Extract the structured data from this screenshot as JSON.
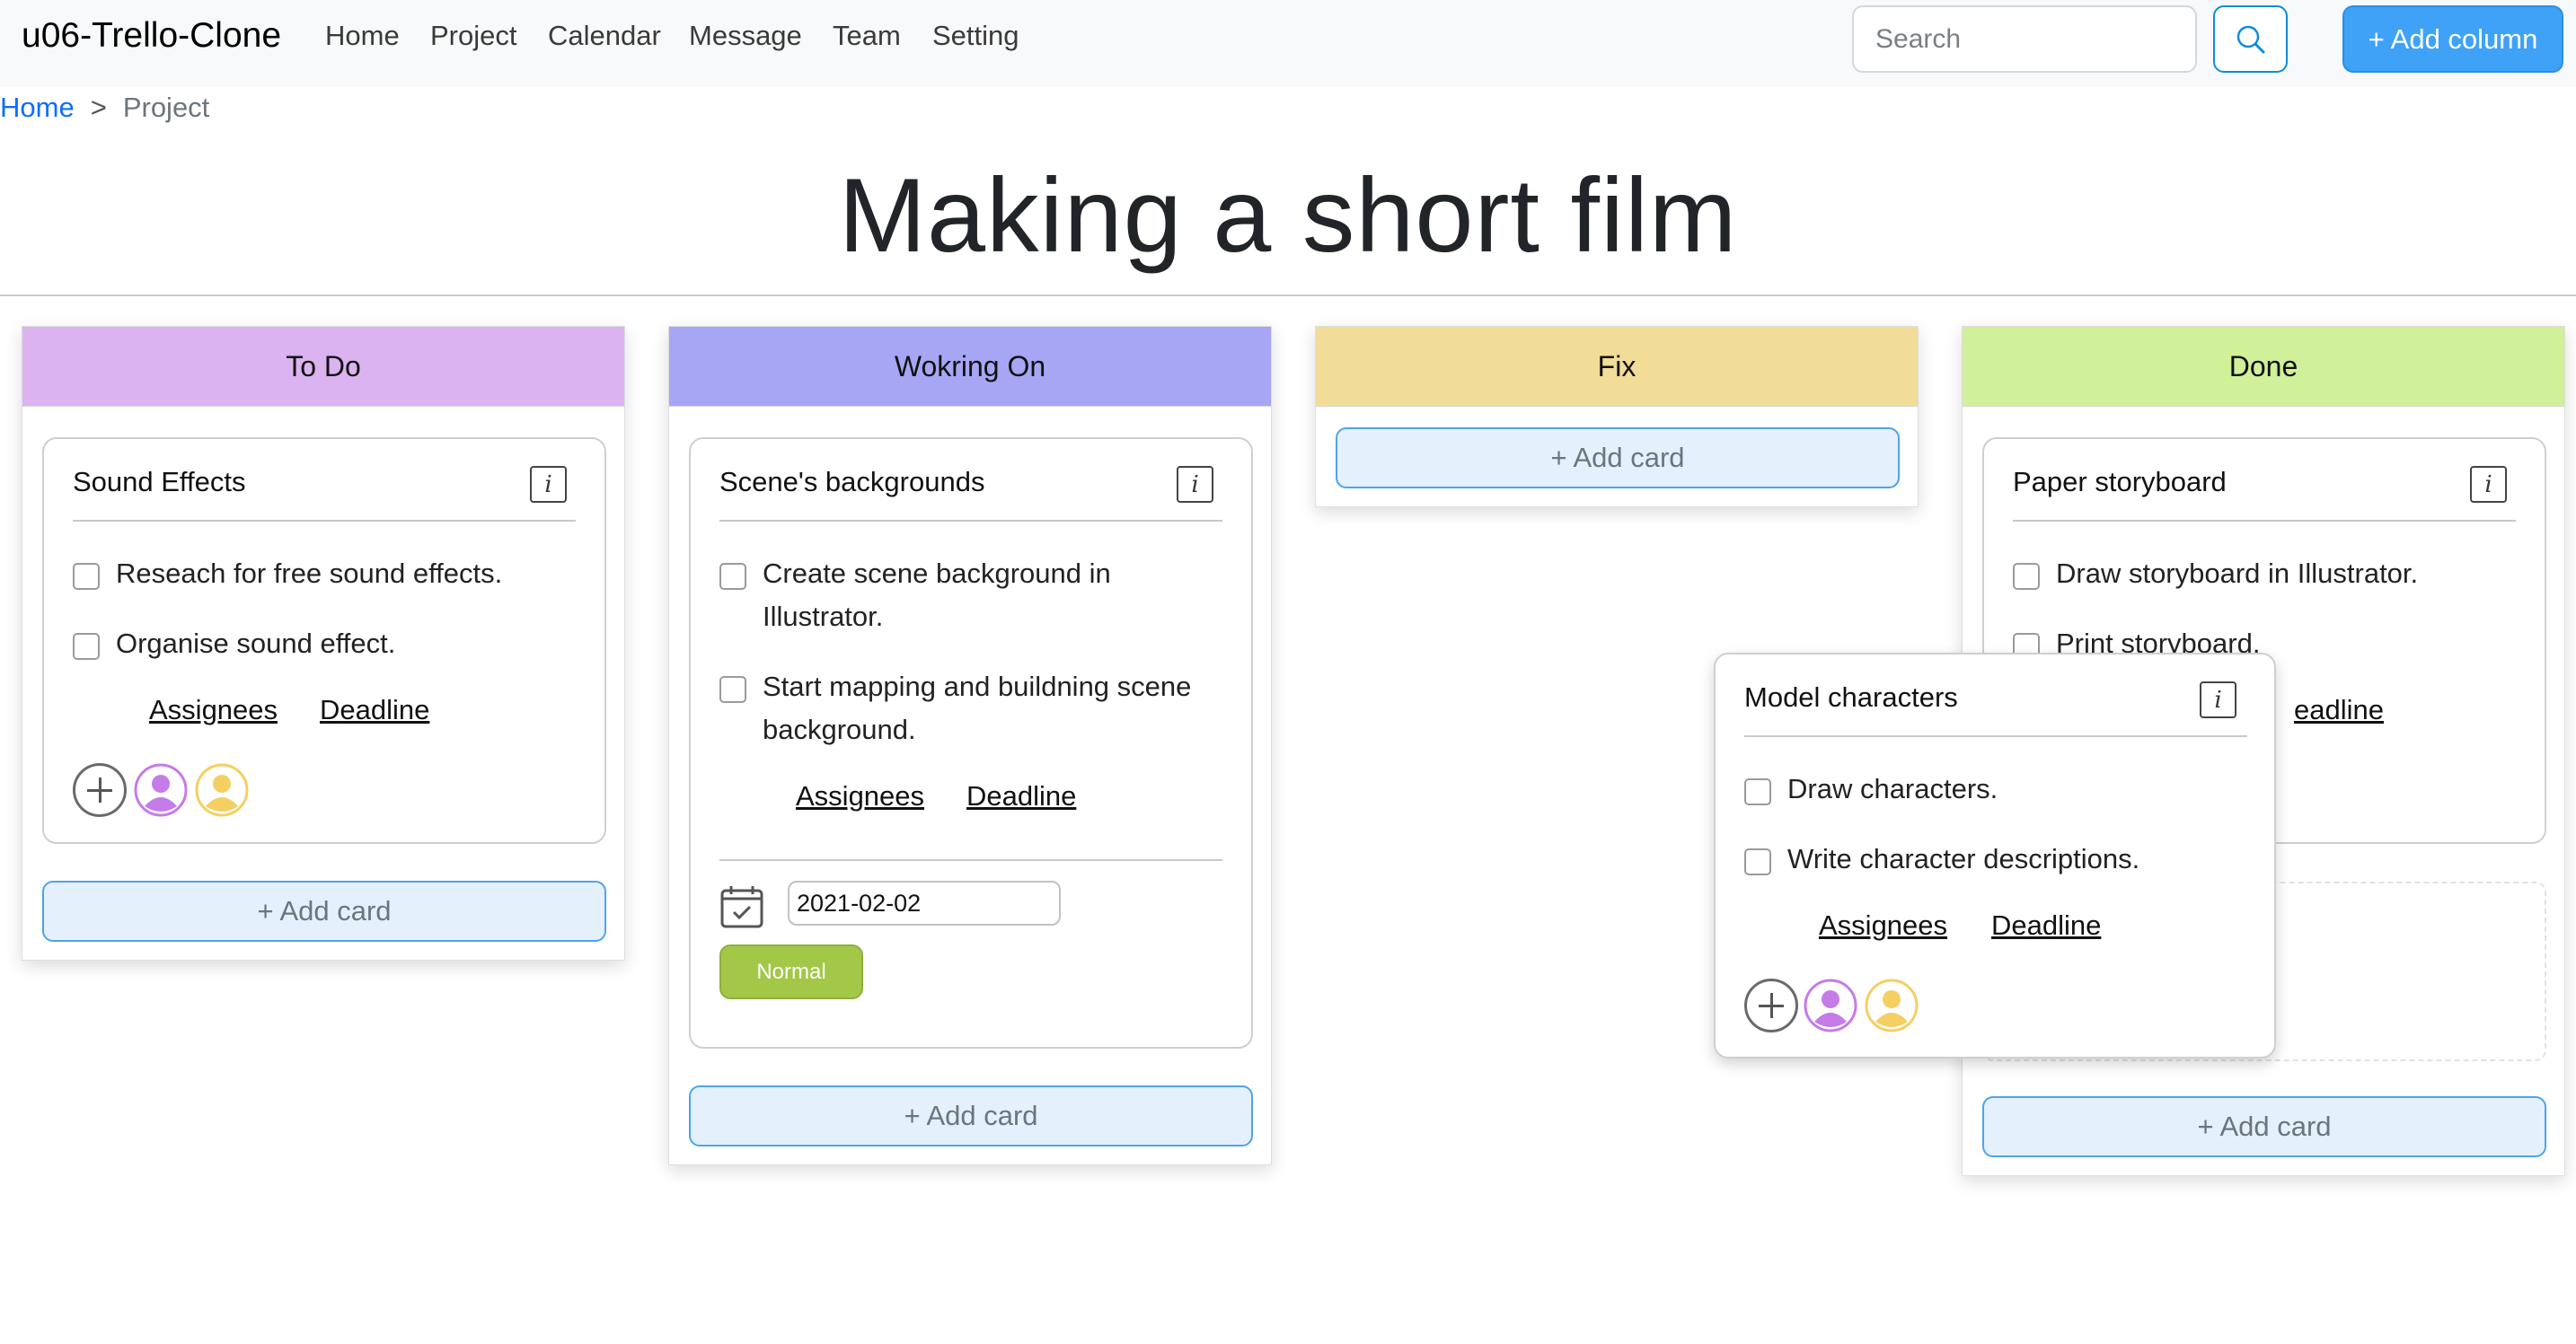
{
  "nav": {
    "brand": "u06-Trello-Clone",
    "links": [
      "Home",
      "Project",
      "Calendar",
      "Message",
      "Team",
      "Setting"
    ],
    "search_placeholder": "Search",
    "add_column": "+ Add column"
  },
  "breadcrumb": {
    "home": "Home",
    "sep": ">",
    "current": "Project"
  },
  "page_title": "Making a short film",
  "columns": [
    {
      "title": "To Do",
      "color": "#dbb3f0",
      "add_card": "+ Add card"
    },
    {
      "title": "Wokring On",
      "color": "#a7a6f5",
      "add_card": "+ Add card"
    },
    {
      "title": "Fix",
      "color": "#f1dc98",
      "add_card": "+ Add card"
    },
    {
      "title": "Done",
      "color": "#d0f09a",
      "add_card": "+ Add card"
    }
  ],
  "cards": {
    "sound": {
      "title": "Sound Effects",
      "tasks": [
        "Reseach for free sound effects.",
        "Organise sound effect."
      ],
      "assignees": "Assignees",
      "deadline": "Deadline"
    },
    "scene": {
      "title": "Scene's backgrounds",
      "tasks": [
        [
          "Create scene background in",
          "Illustrator."
        ],
        [
          "Start mapping and buildning scene",
          "background."
        ]
      ],
      "assignees": "Assignees",
      "deadline": "Deadline",
      "date": "2021-02-02",
      "priority": "Normal"
    },
    "paper": {
      "title": "Paper storyboard",
      "tasks": [
        "Draw storyboard in Illustrator.",
        "Print storyboard."
      ],
      "deadline_partial": "eadline"
    },
    "model": {
      "title": "Model characters",
      "tasks": [
        "Draw characters.",
        "Write character descriptions."
      ],
      "assignees": "Assignees",
      "deadline": "Deadline"
    }
  },
  "colors": {
    "accent": "#3fa2f7",
    "avatar_purple": "#c57be8",
    "avatar_yellow": "#f5cf62"
  }
}
